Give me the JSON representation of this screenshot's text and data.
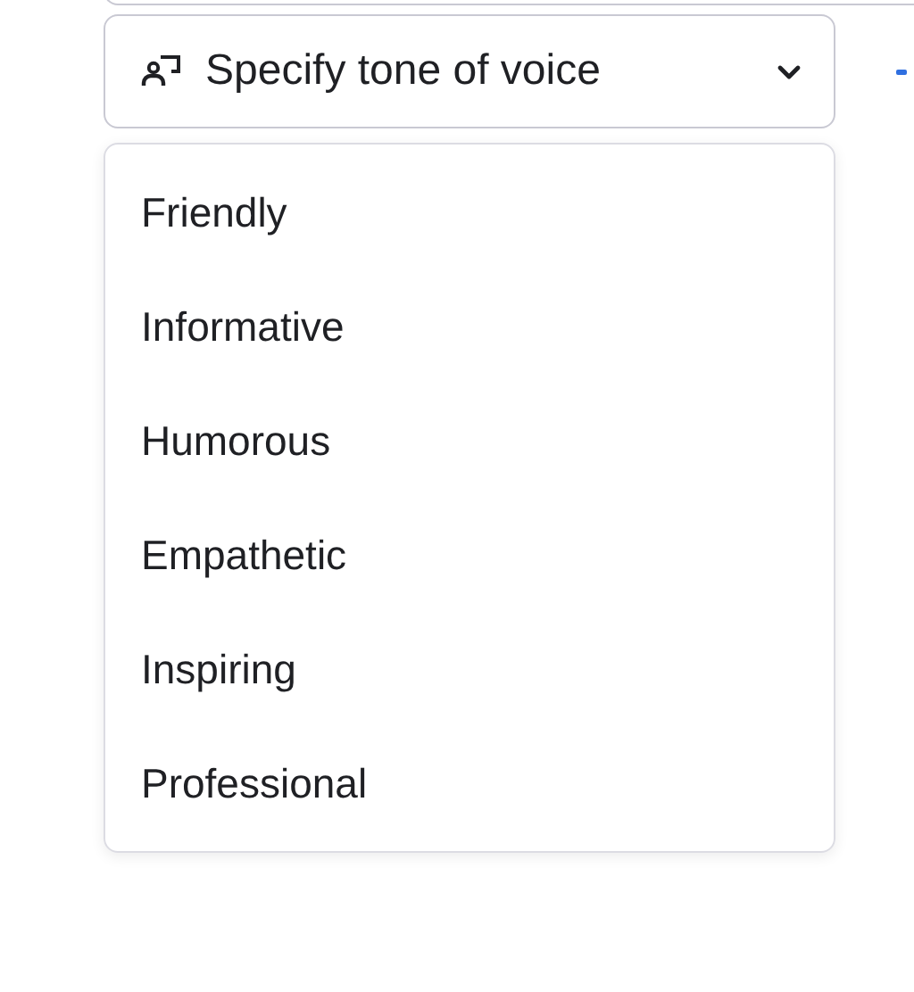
{
  "tone_select": {
    "label": "Specify tone of voice",
    "expanded": true
  },
  "options": [
    {
      "label": "Friendly"
    },
    {
      "label": "Informative"
    },
    {
      "label": "Humorous"
    },
    {
      "label": "Empathetic"
    },
    {
      "label": "Inspiring"
    },
    {
      "label": "Professional"
    }
  ]
}
